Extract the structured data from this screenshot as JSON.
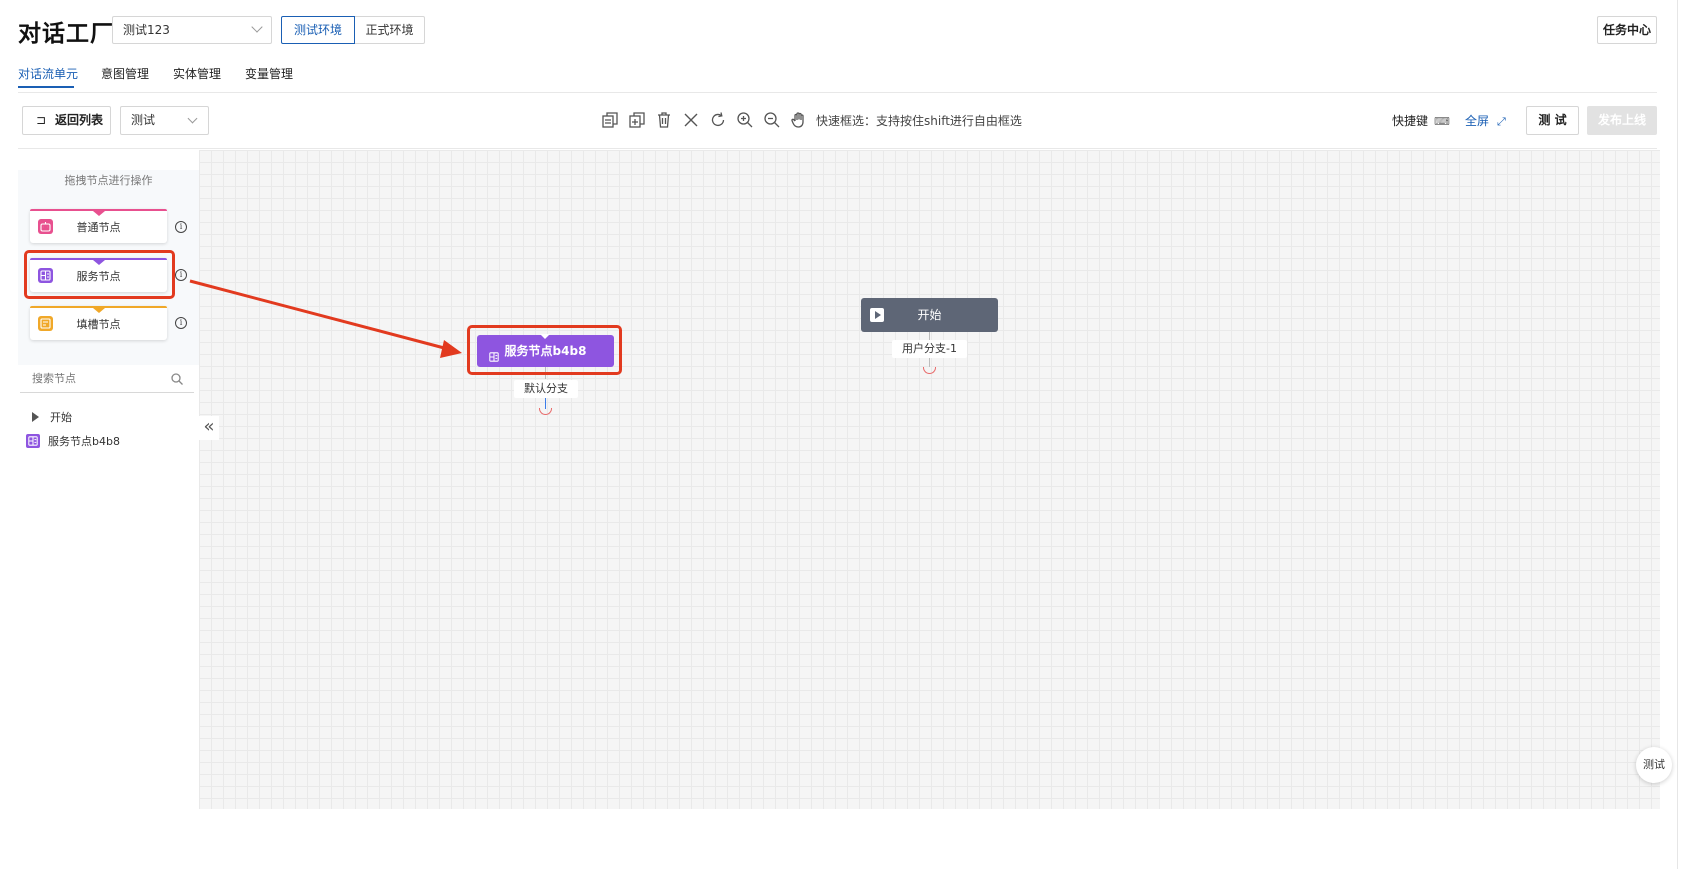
{
  "header": {
    "app_title": "对话工厂",
    "project_select": "测试123",
    "env_test": "测试环境",
    "env_prod": "正式环境",
    "task_center": "任务中心"
  },
  "tabs": [
    {
      "label": "对话流单元",
      "active": true
    },
    {
      "label": "意图管理",
      "active": false
    },
    {
      "label": "实体管理",
      "active": false
    },
    {
      "label": "变量管理",
      "active": false
    }
  ],
  "toolbar": {
    "back_label": "返回列表",
    "mode_select": "测试",
    "tool_icons": [
      "copy-icon",
      "paste-icon",
      "delete-icon",
      "close-icon",
      "refresh-icon",
      "zoom-in-icon",
      "zoom-out-icon",
      "hand-icon"
    ],
    "quick_select": "快速框选：支持按住shift进行自由框选",
    "shortcut_label": "快捷键",
    "fullscreen_label": "全屏",
    "test_label": "测 试",
    "publish_label": "发布上线"
  },
  "left_panel": {
    "drag_hint": "拖拽节点进行操作",
    "palette": [
      {
        "label": "普通节点",
        "color": "#e8508f",
        "icon": "robot-icon"
      },
      {
        "label": "服务节点",
        "color": "#8e55e0",
        "icon": "service-icon"
      },
      {
        "label": "填槽节点",
        "color": "#f0a829",
        "icon": "slot-icon"
      }
    ],
    "search_placeholder": "搜索节点",
    "tree": [
      {
        "label": "开始",
        "icon": "play-icon"
      },
      {
        "label": "服务节点b4b8",
        "icon": "service-icon"
      }
    ]
  },
  "canvas": {
    "service_node": {
      "label": "服务节点b4b8",
      "branch": "默认分支",
      "color": "#8e55e0"
    },
    "start_node": {
      "label": "开始",
      "branch": "用户分支-1",
      "color": "#5e6676"
    }
  },
  "float_test": "测试",
  "colors": {
    "accent": "#1a5fb4",
    "highlight": "#e23a1f"
  }
}
